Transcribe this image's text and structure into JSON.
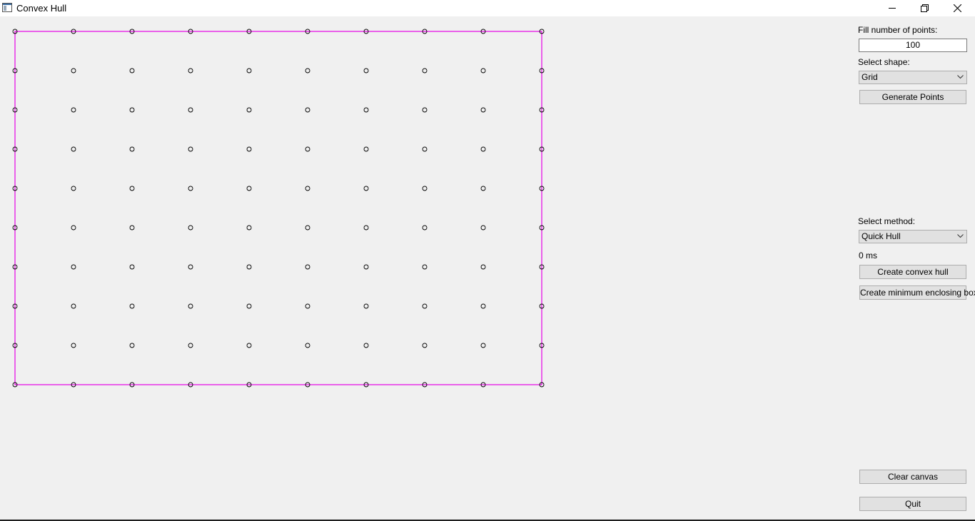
{
  "window": {
    "title": "Convex Hull",
    "minimize_icon": "minimize-icon",
    "restore_icon": "restore-icon",
    "close_icon": "close-icon"
  },
  "canvas": {
    "hull_color": "#e600e6",
    "point_color": "#000000",
    "grid_columns": 10,
    "grid_rows": 10
  },
  "panel": {
    "fill_label": "Fill number of points:",
    "fill_value": "100",
    "shape_label": "Select shape:",
    "shape_value": "Grid",
    "generate_label": "Generate Points",
    "method_label": "Select method:",
    "method_value": "Quick Hull",
    "time_text": "0 ms",
    "hull_button": "Create convex hull",
    "box_button": "Create minimum enclosing box",
    "clear_button": "Clear canvas",
    "quit_button": "Quit"
  }
}
